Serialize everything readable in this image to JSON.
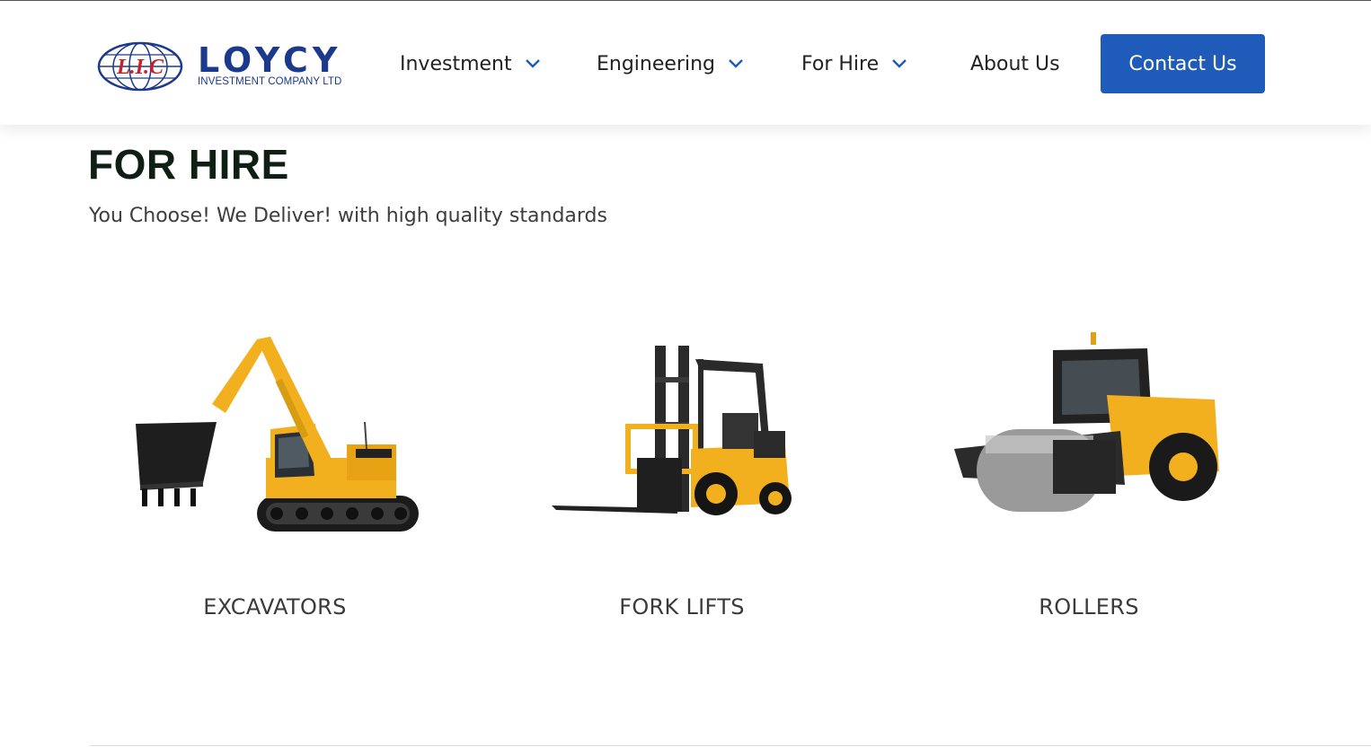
{
  "brand": {
    "emblem_text": "L.I.C",
    "name": "LOYCY",
    "tagline": "INVESTMENT COMPANY LTD"
  },
  "nav": {
    "items": [
      {
        "label": "Investment",
        "has_dropdown": true
      },
      {
        "label": "Engineering",
        "has_dropdown": true
      },
      {
        "label": "For Hire",
        "has_dropdown": true
      },
      {
        "label": "About Us",
        "has_dropdown": false
      }
    ],
    "cta_label": "Contact Us"
  },
  "page": {
    "title": "FOR HIRE",
    "subtitle": "You Choose! We Deliver! with high quality standards"
  },
  "equipment": [
    {
      "label": "EXCAVATORS",
      "image": "excavator-image"
    },
    {
      "label": "FORK LIFTS",
      "image": "forklift-image"
    },
    {
      "label": "ROLLERS",
      "image": "roller-image"
    }
  ],
  "colors": {
    "brand_blue": "#1c3a8c",
    "cta_blue": "#1f5bb8",
    "emblem_red": "#c8202a",
    "machine_yellow": "#f2b01e"
  }
}
